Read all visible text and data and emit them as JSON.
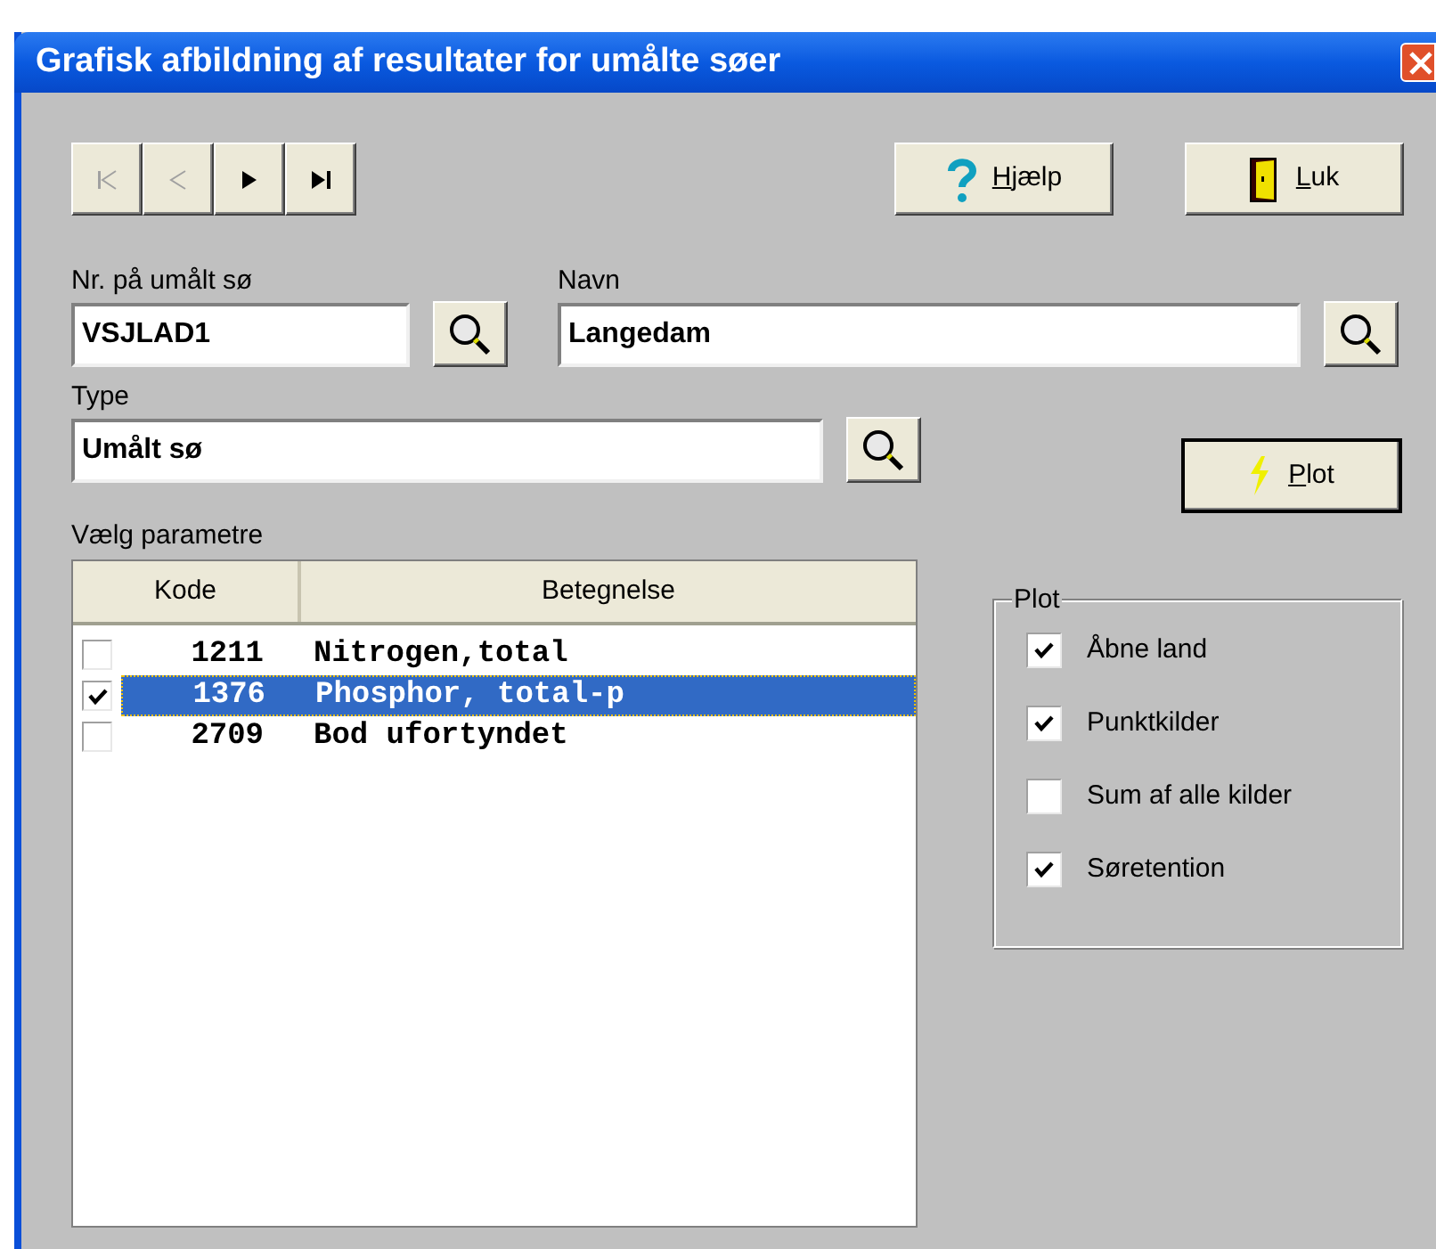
{
  "window": {
    "title": "Grafisk afbildning af resultater for umålte søer"
  },
  "nav_buttons": [
    {
      "kind": "first",
      "disabled": true
    },
    {
      "kind": "previous",
      "disabled": true
    },
    {
      "kind": "next",
      "disabled": false
    },
    {
      "kind": "last",
      "disabled": false
    }
  ],
  "help_button": {
    "label": "Hjælp"
  },
  "close_button": {
    "label": "Luk"
  },
  "lake_number": {
    "label": "Nr. på umålt sø",
    "value": "VSJLAD1"
  },
  "name": {
    "label": "Navn",
    "value": "Langedam"
  },
  "type": {
    "label": "Type",
    "value": "Umålt sø"
  },
  "plot_button": {
    "label": "Plot"
  },
  "parameters": {
    "label": "Vælg parametre",
    "columns": [
      "Kode",
      "Betegnelse"
    ],
    "rows": [
      {
        "code": "1211",
        "name": "Nitrogen,total",
        "checked": false,
        "selected": false
      },
      {
        "code": "1376",
        "name": "Phosphor, total-p",
        "checked": true,
        "selected": true
      },
      {
        "code": "2709",
        "name": "Bod ufortyndet",
        "checked": false,
        "selected": false
      }
    ]
  },
  "plot_group": {
    "title": "Plot",
    "options": [
      {
        "label": "Åbne land",
        "checked": true
      },
      {
        "label": "Punktkilder",
        "checked": true
      },
      {
        "label": "Sum af alle kilder",
        "checked": false
      },
      {
        "label": "Søretention",
        "checked": true
      }
    ]
  }
}
